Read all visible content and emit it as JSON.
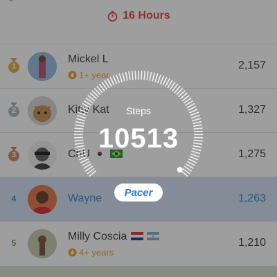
{
  "header": {
    "timer_text": "16 Hours"
  },
  "leaderboard": [
    {
      "rank": "1",
      "name": "Mickel L",
      "tenure": "1+ year",
      "steps": "2,157"
    },
    {
      "rank": "2",
      "name": "Kitty Kat",
      "tenure": "",
      "steps": "1,327"
    },
    {
      "rank": "3",
      "name": "ChU",
      "tenure": "",
      "steps": "1,275"
    },
    {
      "rank": "4",
      "name": "Wayne",
      "tenure": "",
      "steps": "1,263"
    },
    {
      "rank": "5",
      "name": "Milly Coscia",
      "tenure": "4+ years",
      "steps": "1,210"
    }
  ],
  "overlay": {
    "label": "Steps",
    "value": "10513",
    "brand": "Pacer"
  },
  "colors": {
    "accent": "#2e7dd1",
    "timer": "#e53935",
    "gold": "#e89b20"
  }
}
